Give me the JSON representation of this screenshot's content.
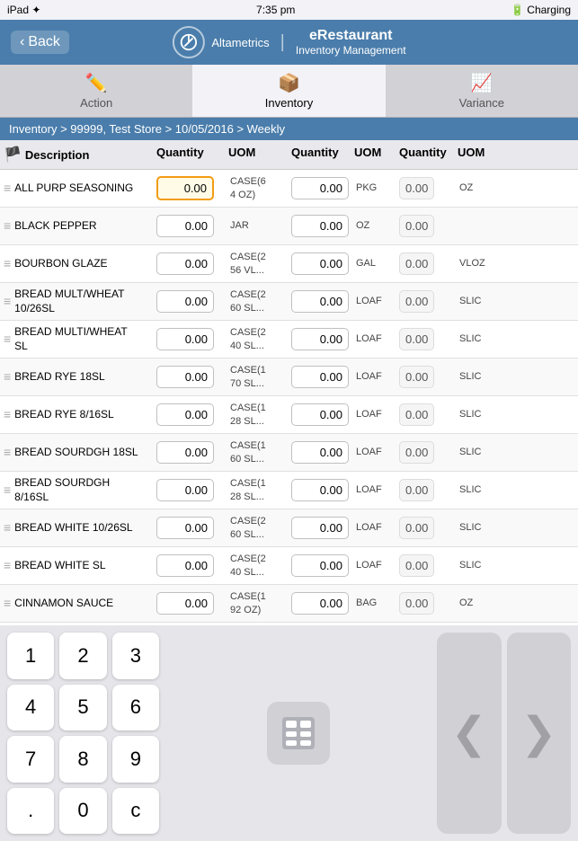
{
  "statusBar": {
    "left": "iPad ✦",
    "time": "7:35 pm",
    "right": "🔋 Charging"
  },
  "header": {
    "backLabel": "Back",
    "brandName": "Altametrics",
    "appName": "eRestaurant",
    "subName": "Inventory Management",
    "divider": "|"
  },
  "tabs": [
    {
      "id": "action",
      "label": "Action",
      "icon": "✏️"
    },
    {
      "id": "inventory",
      "label": "Inventory",
      "icon": "📦",
      "active": true
    },
    {
      "id": "variance",
      "label": "Variance",
      "icon": "📈"
    }
  ],
  "breadcrumb": "Inventory > 99999, Test Store > 10/05/2016 > Weekly",
  "tableHeader": {
    "descLabel": "Description",
    "qty1Label": "Quantity",
    "uom1Label": "UOM",
    "qty2Label": "Quantity",
    "uom2Label": "UOM",
    "qty3Label": "Quantity",
    "uom3Label": "UOM"
  },
  "rows": [
    {
      "desc": "ALL PURP SEASONING",
      "qty1": "0.00",
      "uom1": "CASE(6\n4 OZ)",
      "qty2": "0.00",
      "uom2": "PKG",
      "qty3": "0.00",
      "uom3": "OZ",
      "highlighted": true
    },
    {
      "desc": "BLACK PEPPER",
      "qty1": "0.00",
      "uom1": "JAR",
      "qty2": "0.00",
      "uom2": "OZ",
      "qty3": "0.00",
      "uom3": "",
      "highlighted": false
    },
    {
      "desc": "BOURBON GLAZE",
      "qty1": "0.00",
      "uom1": "CASE(2\n56 VL...",
      "qty2": "0.00",
      "uom2": "GAL",
      "qty3": "0.00",
      "uom3": "VLOZ",
      "highlighted": false
    },
    {
      "desc": "BREAD MULT/WHEAT\n10/26SL",
      "qty1": "0.00",
      "uom1": "CASE(2\n60 SL...",
      "qty2": "0.00",
      "uom2": "LOAF",
      "qty3": "0.00",
      "uom3": "SLIC",
      "highlighted": false
    },
    {
      "desc": "BREAD MULTI/WHEAT\nSL",
      "qty1": "0.00",
      "uom1": "CASE(2\n40 SL...",
      "qty2": "0.00",
      "uom2": "LOAF",
      "qty3": "0.00",
      "uom3": "SLIC",
      "highlighted": false
    },
    {
      "desc": "BREAD RYE 18SL",
      "qty1": "0.00",
      "uom1": "CASE(1\n70 SL...",
      "qty2": "0.00",
      "uom2": "LOAF",
      "qty3": "0.00",
      "uom3": "SLIC",
      "highlighted": false
    },
    {
      "desc": "BREAD RYE 8/16SL",
      "qty1": "0.00",
      "uom1": "CASE(1\n28 SL...",
      "qty2": "0.00",
      "uom2": "LOAF",
      "qty3": "0.00",
      "uom3": "SLIC",
      "highlighted": false
    },
    {
      "desc": "BREAD SOURDGH 18SL",
      "qty1": "0.00",
      "uom1": "CASE(1\n60 SL...",
      "qty2": "0.00",
      "uom2": "LOAF",
      "qty3": "0.00",
      "uom3": "SLIC",
      "highlighted": false
    },
    {
      "desc": "BREAD SOURDGH\n8/16SL",
      "qty1": "0.00",
      "uom1": "CASE(1\n28 SL...",
      "qty2": "0.00",
      "uom2": "LOAF",
      "qty3": "0.00",
      "uom3": "SLIC",
      "highlighted": false
    },
    {
      "desc": "BREAD WHITE 10/26SL",
      "qty1": "0.00",
      "uom1": "CASE(2\n60 SL...",
      "qty2": "0.00",
      "uom2": "LOAF",
      "qty3": "0.00",
      "uom3": "SLIC",
      "highlighted": false
    },
    {
      "desc": "BREAD WHITE SL",
      "qty1": "0.00",
      "uom1": "CASE(2\n40 SL...",
      "qty2": "0.00",
      "uom2": "LOAF",
      "qty3": "0.00",
      "uom3": "SLIC",
      "highlighted": false
    },
    {
      "desc": "CINNAMON SAUCE",
      "qty1": "0.00",
      "uom1": "CASE(1\n92 OZ)",
      "qty2": "0.00",
      "uom2": "BAG",
      "qty3": "0.00",
      "uom3": "OZ",
      "highlighted": false
    }
  ],
  "numpad": {
    "keys": [
      "1",
      "2",
      "3",
      "4",
      "5",
      "6",
      "7",
      "8",
      "9",
      ".",
      "0",
      "c"
    ]
  },
  "navigation": {
    "prevIcon": "❮",
    "nextIcon": "❯"
  }
}
